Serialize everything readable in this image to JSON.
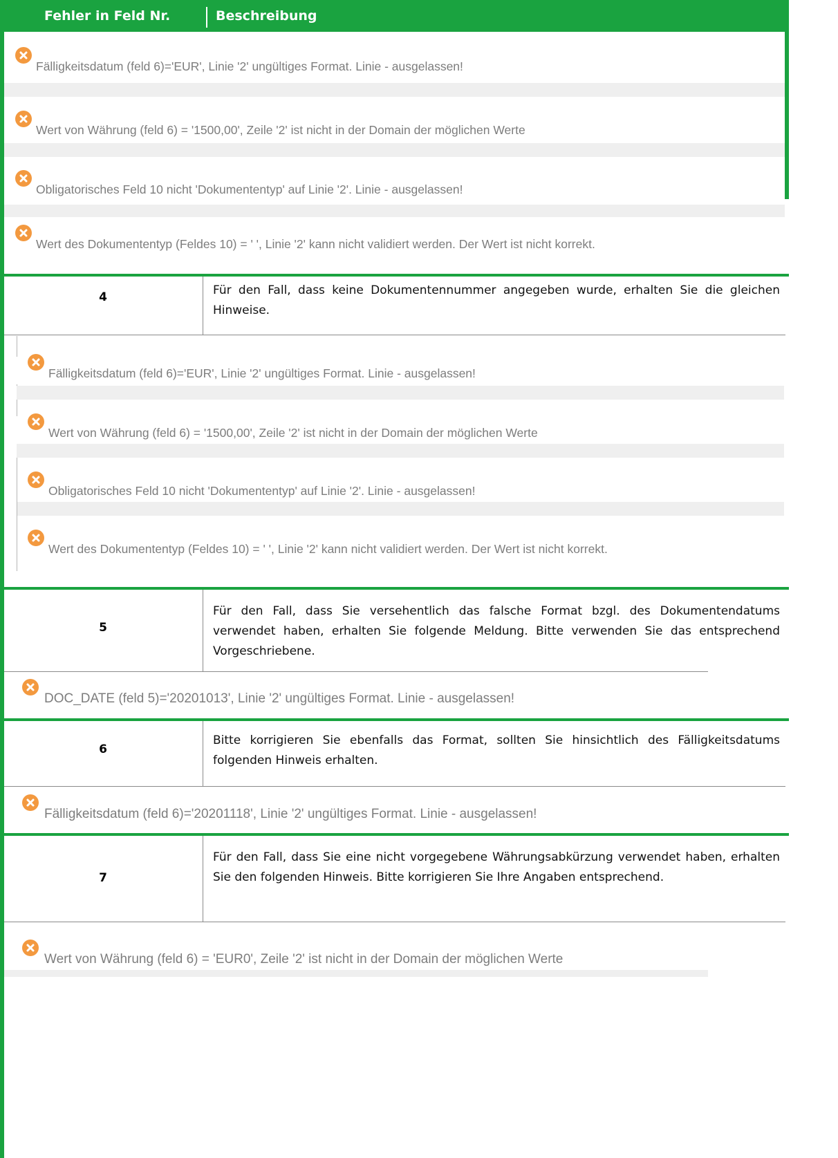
{
  "header": {
    "col1": "Fehler in Feld Nr.",
    "col2": "Beschreibung"
  },
  "block1": [
    "Fälligkeitsdatum (feld 6)='EUR', Linie '2' ungültiges Format. Linie - ausgelassen!",
    "Wert von Währung (feld 6) = '1500,00', Zeile '2' ist nicht in der Domain der möglichen Werte",
    "Obligatorisches Feld 10 nicht 'Dokumententyp' auf Linie '2'. Linie - ausgelassen!",
    "Wert des Dokumententyp (Feldes 10) = ' ', Linie '2' kann nicht validiert werden. Der Wert ist nicht korrekt."
  ],
  "rows": [
    {
      "num": "4",
      "desc": "Für den Fall, dass keine Dokumentennummer angegeben wurde, erhalten Sie die gleichen Hinweise."
    },
    {
      "num": "5",
      "desc": "Für den Fall, dass Sie versehentlich das falsche Format bzgl. des Dokumentendatums verwendet haben, erhalten Sie folgende Meldung. Bitte verwenden Sie das entsprechend Vorgeschriebene."
    },
    {
      "num": "6",
      "desc": "Bitte korrigieren Sie ebenfalls das Format, sollten Sie hinsichtlich des Fälligkeitsdatums folgenden Hinweis erhalten."
    },
    {
      "num": "7",
      "desc": "Für den Fall, dass Sie eine nicht vorgegebene Währungsabkürzung verwendet haben, erhalten Sie den folgenden Hinweis. Bitte korrigieren Sie Ihre Angaben entsprechend."
    }
  ],
  "block2": [
    "Fälligkeitsdatum (feld 6)='EUR', Linie '2' ungültiges Format. Linie - ausgelassen!",
    "Wert von Währung (feld 6) = '1500,00', Zeile '2' ist nicht in der Domain der möglichen Werte",
    "Obligatorisches Feld 10 nicht 'Dokumententyp' auf Linie '2'. Linie - ausgelassen!",
    "Wert des Dokumententyp (Feldes 10) = ' ', Linie '2' kann nicht validiert werden. Der Wert ist nicht korrekt."
  ],
  "block3": "DOC_DATE (feld 5)='20201013', Linie '2' ungültiges Format. Linie - ausgelassen!",
  "block4": "Fälligkeitsdatum (feld 6)='20201118', Linie '2' ungültiges Format. Linie - ausgelassen!",
  "block5": "Wert von Währung (feld 6) = 'EUR0', Zeile '2' ist nicht in der Domain der möglichen Werte",
  "colors": {
    "accent_green": "#1aa340",
    "error_orange": "#f3993f",
    "message_gray": "#7d7d7d"
  }
}
